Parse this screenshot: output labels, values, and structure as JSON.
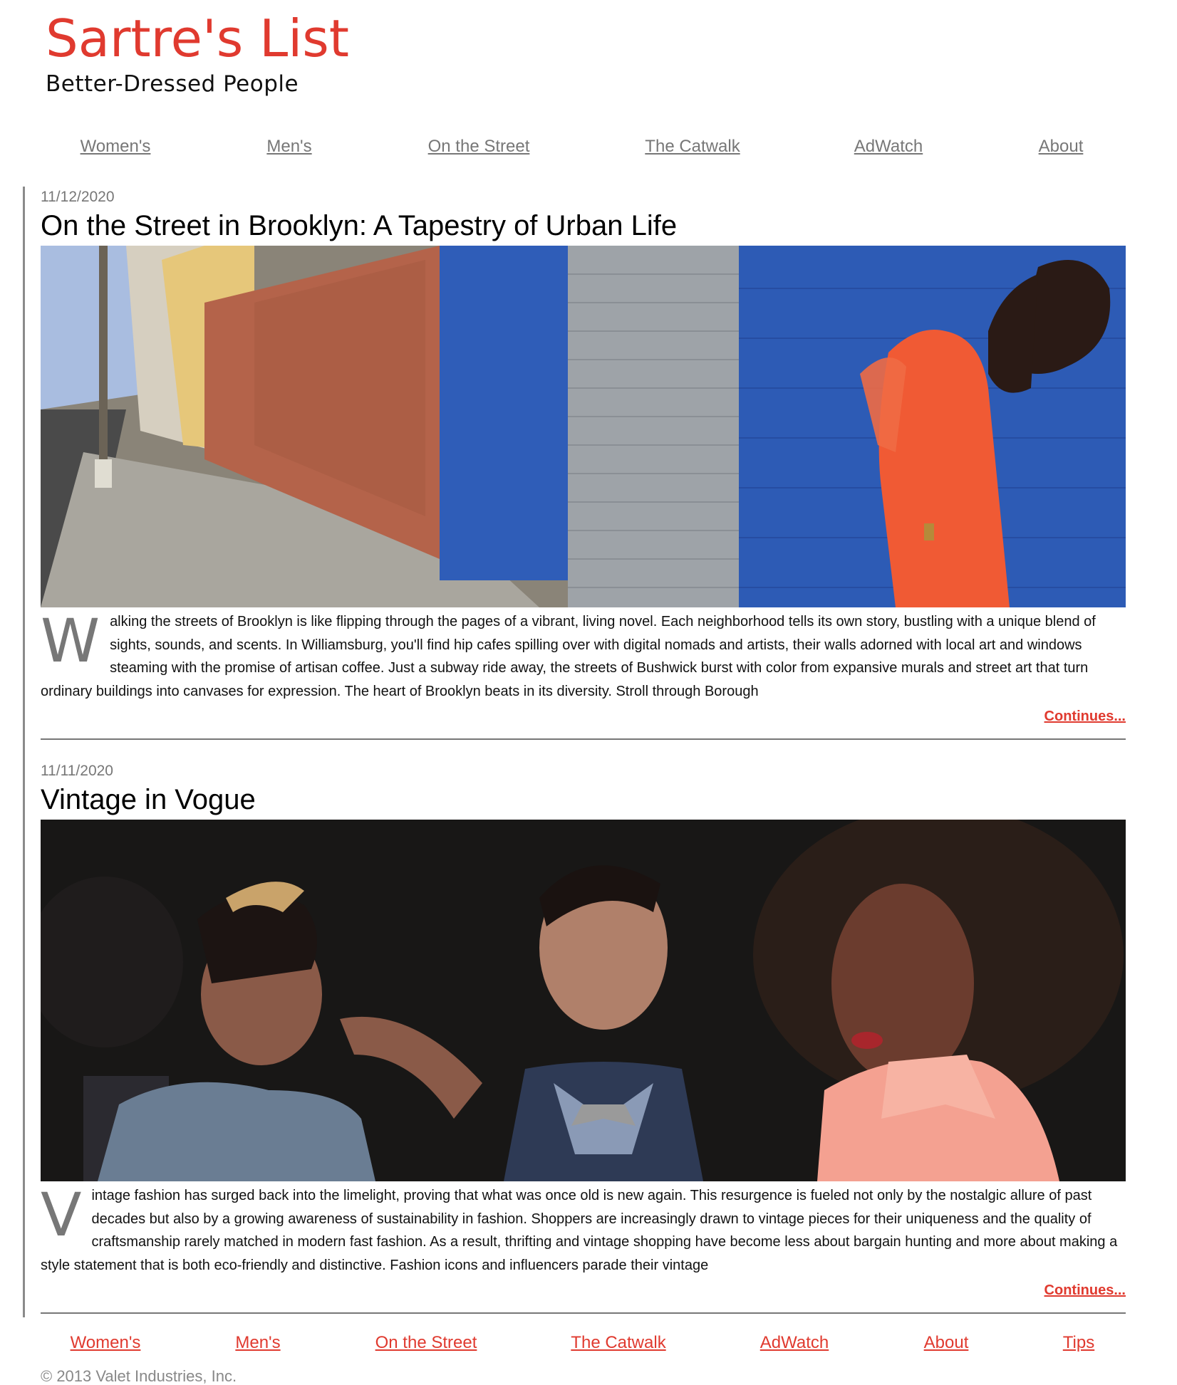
{
  "site": {
    "title": "Sartre's List",
    "tagline": "Better-Dressed People"
  },
  "top_nav": [
    {
      "label": "Women's"
    },
    {
      "label": "Men's"
    },
    {
      "label": "On the Street"
    },
    {
      "label": "The Catwalk"
    },
    {
      "label": "AdWatch"
    },
    {
      "label": "About"
    }
  ],
  "posts": [
    {
      "date": "11/12/2020",
      "title": "On the Street in Brooklyn: A Tapestry of Urban Life",
      "image_desc": "street-photo-woman-orange-dress-blue-wall",
      "dropcap": "W",
      "body": "alking the streets of Brooklyn is like flipping through the pages of a vibrant, living novel. Each neighborhood tells its own story, bustling with a unique blend of sights, sounds, and scents. In Williamsburg, you'll find hip cafes spilling over with digital nomads and artists, their walls adorned with local art and windows steaming with the promise of artisan coffee. Just a subway ride away, the streets of Bushwick burst with color from expansive murals and street art that turn ordinary buildings into canvases for expression. The heart of Brooklyn beats in its diversity. Stroll through Borough",
      "more": "Continues..."
    },
    {
      "date": "11/11/2020",
      "title": "Vintage in Vogue",
      "image_desc": "night-photo-three-people-vintage-style",
      "dropcap": "V",
      "body": "intage fashion has surged back into the limelight, proving that what was once old is new again. This resurgence is fueled not only by the nostalgic allure of past decades but also by a growing awareness of sustainability in fashion. Shoppers are increasingly drawn to vintage pieces for their uniqueness and the quality of craftsmanship rarely matched in modern fast fashion. As a result, thrifting and vintage shopping have become less about bargain hunting and more about making a style statement that is both eco-friendly and distinctive. Fashion icons and influencers parade their vintage",
      "more": "Continues..."
    }
  ],
  "bottom_nav": [
    {
      "label": "Women's"
    },
    {
      "label": "Men's"
    },
    {
      "label": "On the Street"
    },
    {
      "label": "The Catwalk"
    },
    {
      "label": "AdWatch"
    },
    {
      "label": "About"
    },
    {
      "label": "Tips"
    }
  ],
  "footer": {
    "copyright": "© 2013 Valet Industries, Inc."
  },
  "colors": {
    "accent": "#e03a2f",
    "nav_text": "#777777",
    "date_text": "#777777"
  }
}
